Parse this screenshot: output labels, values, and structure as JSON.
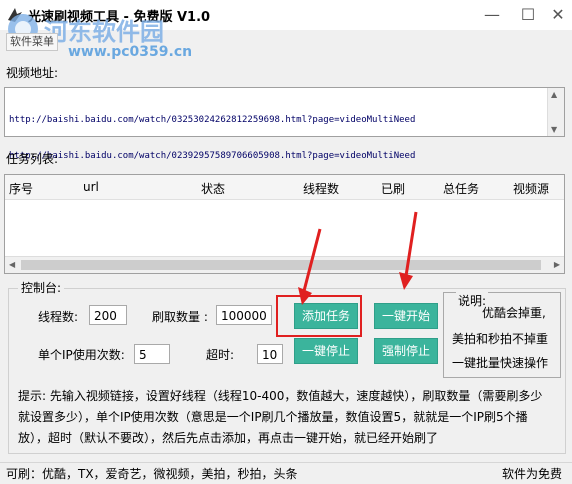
{
  "window": {
    "title": "光速刷视频工具 - 免费版 V1.0",
    "minimize_glyph": "—",
    "maximize_glyph": "☐",
    "close_glyph": "✕"
  },
  "watermark": {
    "logo_text": "河东软件园",
    "url": "www.pc0359.cn"
  },
  "menu": {
    "item": "软件菜单"
  },
  "video": {
    "label": "视频地址:",
    "lines": [
      "http://baishi.baidu.com/watch/03253024262812259698.html?page=videoMultiNeed",
      "http://baishi.baidu.com/watch/02392957589706605908.html?page=videoMultiNeed"
    ]
  },
  "tasks": {
    "label": "任务列表:",
    "columns": [
      "序号",
      "url",
      "状态",
      "线程数",
      "已刷",
      "总任务",
      "视频源"
    ]
  },
  "console": {
    "title": "控制台:",
    "threads_label": "线程数:",
    "threads_value": "200",
    "count_label": "刷取数量 :",
    "count_value": "100000",
    "ip_label": "单个IP使用次数:",
    "ip_value": "5",
    "timeout_label": "超时:",
    "timeout_value": "10",
    "add_task": "添加任务",
    "stop_one": "一键停止",
    "start_one": "一键开始",
    "force_stop": "强制停止",
    "note_title": "说明:",
    "note_lines": [
      "优酷会掉重,",
      "美拍和秒拍不掉重",
      "一键批量快速操作"
    ],
    "hint": "提示: 先输入视频链接，设置好线程（线程10-400，数值越大，速度越快），刷取数量（需要刷多少就设置多少），单个IP使用次数（意思是一个IP刷几个播放量，数值设置5，就就是一个IP刷5个播放），超时（默认不要改），然后先点击添加，再点击一键开始，就已经开始刷了"
  },
  "status": {
    "left": "可刷：优酷，TX，爱奇艺，微视频，美拍，秒拍，头条",
    "right": "软件为免费"
  },
  "colors": {
    "button": "#3bb49c",
    "arrow": "#e02020",
    "highlight": "#e02020"
  }
}
